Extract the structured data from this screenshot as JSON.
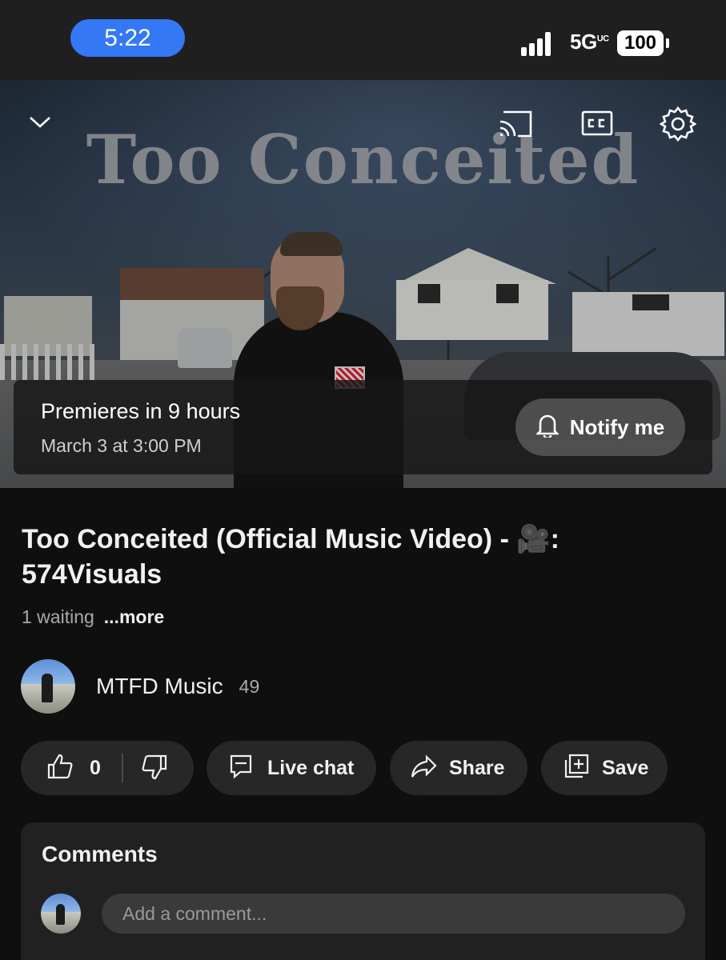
{
  "status_bar": {
    "time": "5:22",
    "network": "5G",
    "network_badge": "UC",
    "battery": "100"
  },
  "player": {
    "thumbnail_text": "Too Conceited",
    "icons": [
      "chevron-down-icon",
      "cast-icon",
      "captions-icon",
      "gear-icon"
    ],
    "premiere_text": "Premieres in 9 hours",
    "premiere_date": "March 3 at 3:00 PM",
    "notify_label": "Notify me"
  },
  "video": {
    "title": "Too Conceited (Official Music Video) - 🎥: 574Visuals",
    "waiting": "1 waiting",
    "more_label": "...more"
  },
  "channel": {
    "name": "MTFD Music",
    "subscribers": "49"
  },
  "actions": {
    "like_count": "0",
    "live_chat_label": "Live chat",
    "share_label": "Share",
    "save_label": "Save"
  },
  "comments": {
    "title": "Comments",
    "placeholder": "Add a comment..."
  },
  "colors": {
    "background": "#0f0f0f",
    "status_bar": "#1f1f1f",
    "time_pill": "#3478f6",
    "pill_bg": "#272727",
    "comments_bg": "#212121"
  }
}
